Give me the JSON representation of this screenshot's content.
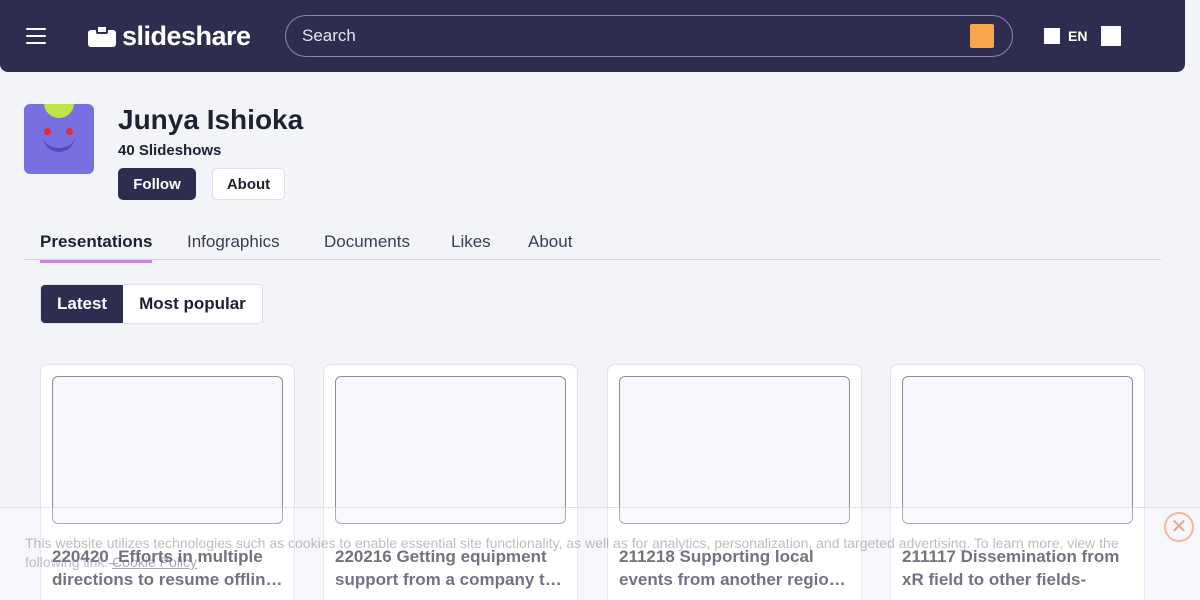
{
  "header": {
    "logo_text": "slideshare",
    "search_placeholder": "Search",
    "language": "EN"
  },
  "profile": {
    "name": "Junya Ishioka",
    "slideshow_count": "40 Slideshows",
    "follow_label": "Follow",
    "about_label": "About"
  },
  "tabs": [
    {
      "label": "Presentations",
      "active": true
    },
    {
      "label": "Infographics",
      "active": false
    },
    {
      "label": "Documents",
      "active": false
    },
    {
      "label": "Likes",
      "active": false
    },
    {
      "label": "About",
      "active": false
    }
  ],
  "sort": {
    "latest": "Latest",
    "popular": "Most popular"
  },
  "cards": [
    {
      "line1": "220420_Efforts in multiple",
      "line2": "directions to resume offline events"
    },
    {
      "line1": "220216 Getting equipment",
      "line2": "support from a company to realize"
    },
    {
      "line1": "211218 Supporting local",
      "line2": "events from another region online"
    },
    {
      "line1": "211117 Dissemination from",
      "line2": "xR field to other fields-"
    }
  ],
  "cookie": {
    "text": "This website utilizes technologies such as cookies to enable essential site functionality, as well as for analytics, personalization, and targeted advertising. To learn more, view the following link: ",
    "link": "Cookie Policy",
    "close": "✕"
  },
  "colors": {
    "brand_dark": "#2e2d4f",
    "search_accent": "#f8a54b",
    "tab_underline": "#c38bd9"
  }
}
